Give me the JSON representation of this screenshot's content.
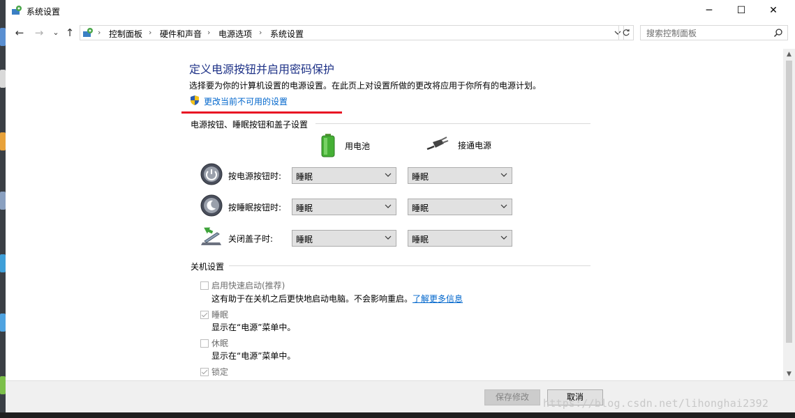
{
  "window": {
    "title": "系统设置"
  },
  "controls": {
    "minimize": "─",
    "maximize": "☐",
    "close": "✕"
  },
  "nav": {
    "back": "←",
    "forward": "→",
    "recent": "⌄",
    "up": "↑"
  },
  "breadcrumb": [
    "控制面板",
    "硬件和声音",
    "电源选项",
    "系统设置"
  ],
  "breadcrumb_sep": "›",
  "search": {
    "placeholder": "搜索控制面板"
  },
  "page": {
    "title": "定义电源按钮并启用密码保护",
    "description": "选择要为你的计算机设置的电源设置。在此页上对设置所做的更改将应用于你所有的电源计划。",
    "change_link": "更改当前不可用的设置"
  },
  "power_buttons": {
    "group_title": "电源按钮、睡眠按钮和盖子设置",
    "col_battery": "用电池",
    "col_plugged": "接通电源",
    "rows": [
      {
        "label": "按电源按钮时:",
        "battery": "睡眠",
        "plugged": "睡眠"
      },
      {
        "label": "按睡眠按钮时:",
        "battery": "睡眠",
        "plugged": "睡眠"
      },
      {
        "label": "关闭盖子时:",
        "battery": "睡眠",
        "plugged": "睡眠"
      }
    ]
  },
  "shutdown": {
    "group_title": "关机设置",
    "items": [
      {
        "label": "启用快速启动(推荐)",
        "checked": false,
        "desc": "这有助于在关机之后更快地启动电脑。不会影响重启。",
        "link": "了解更多信息"
      },
      {
        "label": "睡眠",
        "checked": true,
        "desc": "显示在“电源”菜单中。"
      },
      {
        "label": "休眠",
        "checked": false,
        "desc": "显示在“电源”菜单中。"
      },
      {
        "label": "锁定",
        "checked": true
      }
    ]
  },
  "footer": {
    "save": "保存修改",
    "cancel": "取消"
  },
  "watermark": "https://blog.csdn.net/lihonghai2392",
  "colors": {
    "title_blue": "#1e3287",
    "link_blue": "#0066cc",
    "highlight_red": "#e81123"
  }
}
